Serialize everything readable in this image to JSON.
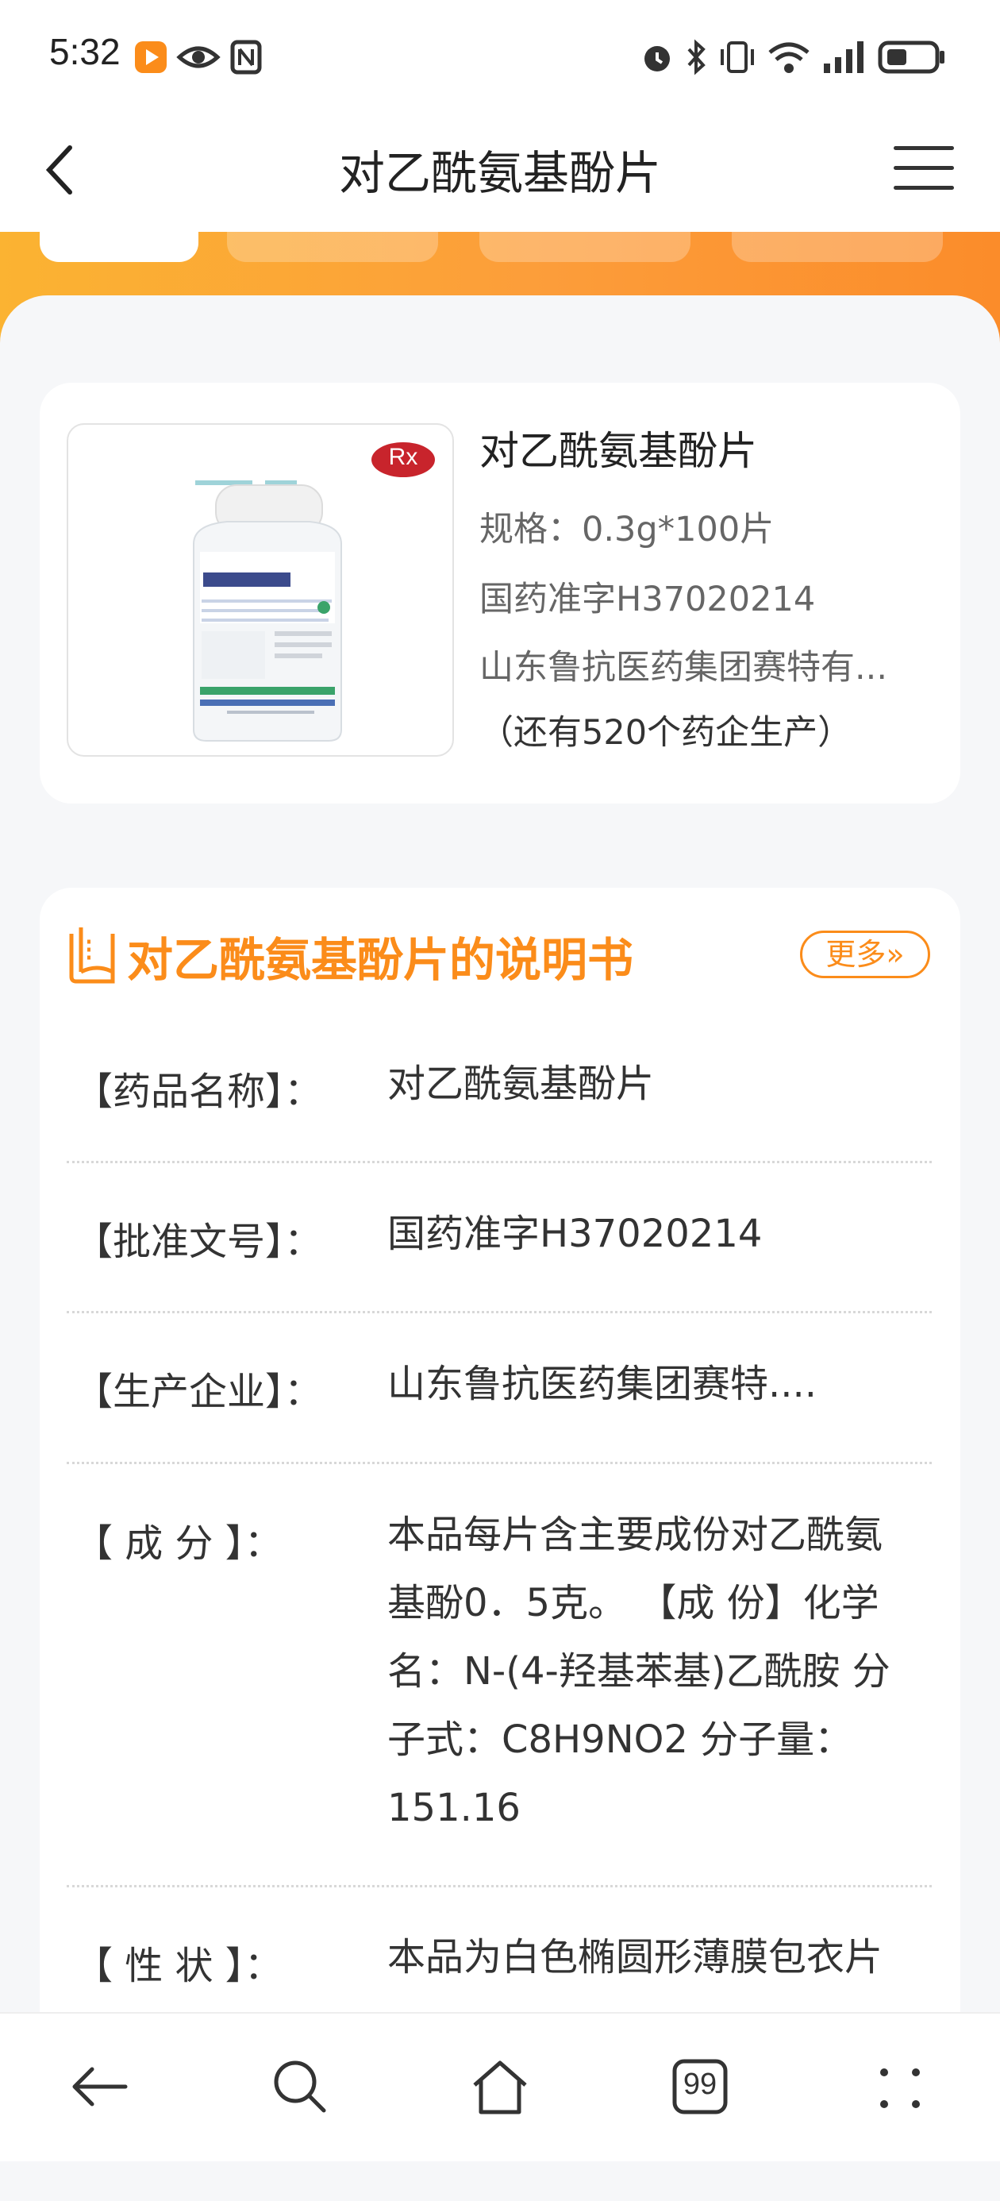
{
  "status_bar": {
    "time": "5:32"
  },
  "nav": {
    "title": "对乙酰氨基酚片"
  },
  "product": {
    "name": "对乙酰氨基酚片",
    "badge": "Rx",
    "spec": "规格：0.3g*100片",
    "approval": "国药准字H37020214",
    "manufacturer": "山东鲁抗医药集团赛特有...",
    "other_makers": "（还有520个药企生产）"
  },
  "instructions": {
    "title": "对乙酰氨基酚片的说明书",
    "more_label": "更多»",
    "rows": [
      {
        "label": "【药品名称】：",
        "value": "对乙酰氨基酚片"
      },
      {
        "label": "【批准文号】：",
        "value": "国药准字H37020214"
      },
      {
        "label": "【生产企业】：",
        "value": "山东鲁抗医药集团赛特...."
      },
      {
        "label": "【 成 分 】：",
        "value": "本品每片含主要成份对乙酰氨基酚0．5克。 【成 份】化学名：N-(4-羟基苯基)乙酰胺 分子式：C8H9NO2 分子量：151.16"
      },
      {
        "label": "【 性 状 】：",
        "value": "本品为白色椭圆形薄膜包衣片"
      }
    ]
  },
  "bottom_nav": {
    "tabs_badge": "99"
  },
  "colors": {
    "accent": "#fb8c1a",
    "banner_start": "#fbb332",
    "banner_end": "#fb8c2a"
  }
}
